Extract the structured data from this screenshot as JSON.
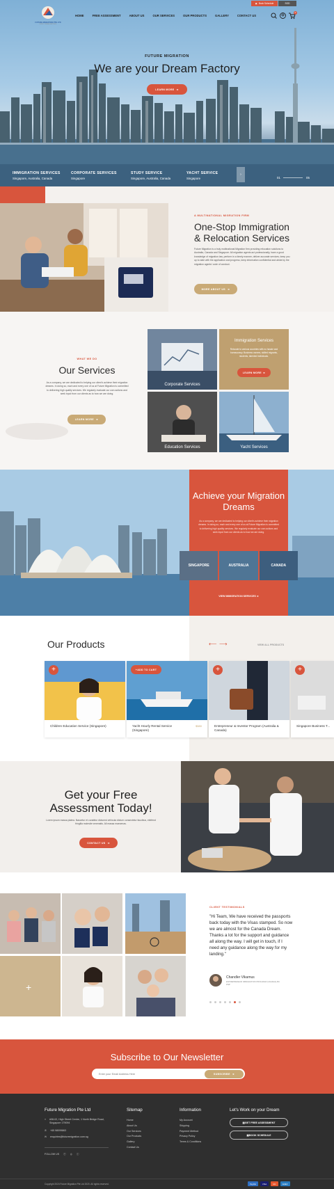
{
  "header": {
    "logo_text": "FUTURE MIGRATION PTE LTD",
    "logo_sub": "EVERY DREAM MATTERS",
    "book_label": "Book Schedule",
    "currency": "SGD",
    "nav": [
      "HOME",
      "FREE ASSESSMENT",
      "ABOUT US",
      "OUR SERVICES",
      "OUR PRODUCTS",
      "GALLERY",
      "CONTACT US"
    ],
    "cart_count": "0"
  },
  "hero": {
    "eyebrow": "FUTURE MIGRATION",
    "title": "We are your Dream Factory",
    "button": "LEARN MORE",
    "services": [
      {
        "title": "IMMIGRATION SERVICES",
        "sub": "Singapore, Australia, Canada"
      },
      {
        "title": "CORPORATE SERVICES",
        "sub": "Singapore"
      },
      {
        "title": "STUDY SERVICE",
        "sub": "Singapore, Australia, Canada"
      },
      {
        "title": "YACHT SERVICE",
        "sub": "Singapore"
      }
    ],
    "slide_current": "01",
    "slide_total": "05"
  },
  "about": {
    "eyebrow": "A MULTINATIONAL MIGRATION FIRM",
    "title": "One-Stop Immigration & Relocation Services",
    "text": "Future Migration is a truly multinational Migration firm providing relocation solutions to Australia, Canada and Singapore. All migration agents act professionally, have a good knowledge of migration law, perform in a timely manner, deliver accurate services; keep you up to date with the application and progress, keep information confidential and abide by the migration agents' code of conduct.",
    "button": "MORE ABOUT US"
  },
  "services": {
    "eyebrow": "WHAT WE DO",
    "title": "Our Services",
    "text": "As a company, we are dedicated to helping our client's achieve their migration dreams. In doing so, each and every one of us at Future Migration is committed to delivering high quality services. We regularly evaluate our own actions and seek input from our clients as to how we are doing.",
    "button": "LEARN MORE",
    "tiles": [
      "Corporate Services",
      "Immigration Services",
      "Education Services",
      "Yacht Services"
    ],
    "feature_text": "Relocate to various countries with no hassle and bureaucracy. Business owners, skilled migrants, students, talented individuals.",
    "feature_button": "LEARN MORE"
  },
  "dreams": {
    "title": "Achieve your Migration Dreams",
    "text": "As a company, we are dedicated to helping our client's achieve their migration dreams. In doing so, each and every one of us at Future Migration is committed to delivering high quality services. We regularly evaluate our own actions and seek input from our clients as to how we are doing.",
    "countries": [
      "SINGAPORE",
      "AUSTRALIA",
      "CANADA"
    ],
    "link": "VIEW IMMIGRATION SERVICES"
  },
  "products": {
    "title": "Our Products",
    "view_all": "VIEW ALL PRODUCTS",
    "add_label": "ADD TO CART",
    "items": [
      {
        "name": "Children Education Service (Singapore)",
        "price": ""
      },
      {
        "name": "Yacht Hourly Rental Service (Singapore)",
        "price": "$580"
      },
      {
        "name": "Entrepreneur & Investor Program (Australia & Canada)",
        "price": ""
      },
      {
        "name": "Singapore Business T...",
        "price": ""
      }
    ]
  },
  "assessment": {
    "title": "Get your Free Assessment Today!",
    "text": "Lorem ipsum massa platea. Nascetur et curabitur dictumst vehicula dictum consectetur faucibus, eleifend fringilla molestie venenatis. All massa maecenas.",
    "button": "CONTACT US"
  },
  "testimonial": {
    "eyebrow": "CLIENT TESTIMONIALS",
    "quote": "\"Hi Team, We have received the passports back today with the Visas stamped. So now we are almost for the Canada Dream. Thanks a lot for the support and guidance all along the way. I will get in touch, if I need any guidance along the way for my landing.\"",
    "name": "Chandler Vikamus",
    "role": "ENTREPRENEUR IMMIGRATION PROGRAM (CANADA)-BC PNP",
    "dots": 7,
    "active_dot": 5
  },
  "newsletter": {
    "title": "Subscribe to Our Newsletter",
    "placeholder": "Enter your Email Address Here",
    "button": "SUBSCRIBE"
  },
  "footer": {
    "company": "Future Migration Pte Ltd",
    "address": "#08-02, High Street Centre, 1 North Bridge Road, Singapore 179094",
    "phone": "+65 98099863",
    "email": "enquiries@futuremigration.com.sg",
    "follow": "FOLLOW US",
    "sitemap_title": "Sitemap",
    "sitemap": [
      "Home",
      "About Us",
      "Our Services",
      "Our Products",
      "Gallery",
      "Contact Us"
    ],
    "info_title": "Information",
    "info": [
      "My Account",
      "Shipping",
      "Payment Method",
      "Privacy Policy",
      "Terms & Conditions"
    ],
    "dream_title": "Let's Work on your Dream",
    "dream_buttons": [
      "GET FREE ASSESSMENT",
      "BOOK SCHEDULE"
    ],
    "copyright": "Copyright 2024 Future Migration Pte Ltd 2020. All rights reserved.",
    "payments": [
      "PayPal",
      "VISA",
      "MC",
      "AMEX"
    ]
  },
  "colors": {
    "accent": "#d8553d",
    "gold": "#c9aa76",
    "footer": "#2f2f2f"
  }
}
